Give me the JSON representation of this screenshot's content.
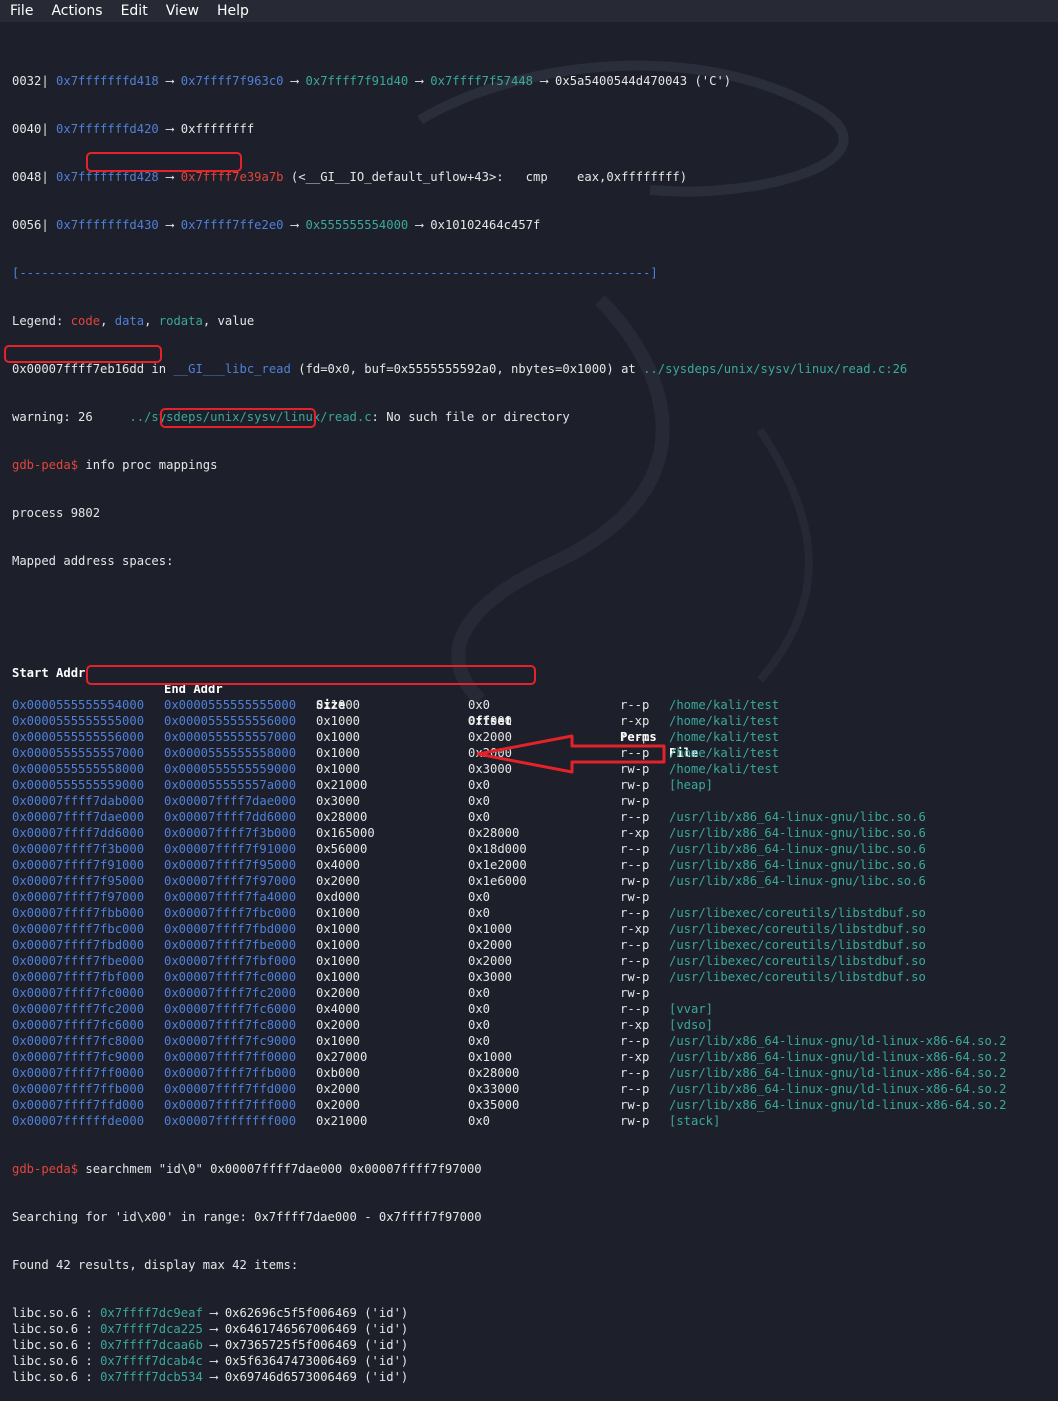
{
  "menu": [
    "File",
    "Actions",
    "Edit",
    "View",
    "Help"
  ],
  "stack_lines": [
    {
      "off": "0032|",
      "a": "0x7fffffffd418",
      "b": "0x7ffff7f963c0",
      "c": "0x7ffff7f91d40",
      "d": "0x7ffff7f57448",
      "e": "0x5a5400544d470043 ('C')"
    },
    {
      "off": "0040|",
      "a": "0x7fffffffd420",
      "b": "0xffffffff"
    },
    {
      "off": "0048|",
      "a": "0x7fffffffd428",
      "b": "0x7ffff7e39a7b",
      "c": "(<__GI__IO_default_uflow+43>:",
      "d": "cmp",
      "e": "eax,0xffffffff)"
    },
    {
      "off": "0056|",
      "a": "0x7fffffffd430",
      "b": "0x7ffff7ffe2e0",
      "c": "0x555555554000",
      "d": "0x10102464c457f"
    }
  ],
  "separator": "[--------------------------------------------------------------------------------------]",
  "legend": {
    "prefix": "Legend: ",
    "code": "code",
    "data": "data",
    "rodata": "rodata",
    "value": "value"
  },
  "frame": {
    "addr": "0x00007ffff7eb16dd",
    "in": "in",
    "func": "__GI___libc_read",
    "args_open": "(fd=0x0, buf=0x5555555592a0, nbytes=0x1000)",
    "at": "at",
    "path": "../sysdeps/unix/sysv/linux/read.c:26"
  },
  "warning": {
    "text": "warning: 26",
    "path": "../sysdeps/unix/sysv/linux/read.c",
    "msg": ": No such file or directory"
  },
  "prompt1": {
    "prompt": "gdb-peda$",
    "cmd": "info proc mappings"
  },
  "process": "process 9802",
  "mapped": "Mapped address spaces:",
  "headers": {
    "start": "Start Addr",
    "end": "End Addr",
    "size": "Size",
    "offset": "Offset",
    "perms": "Perms",
    "file": "File"
  },
  "mappings": [
    [
      "0x0000555555554000",
      "0x0000555555555000",
      "0x1000",
      "0x0",
      "r--p",
      "/home/kali/test"
    ],
    [
      "0x0000555555555000",
      "0x0000555555556000",
      "0x1000",
      "0x1000",
      "r-xp",
      "/home/kali/test"
    ],
    [
      "0x0000555555556000",
      "0x0000555555557000",
      "0x1000",
      "0x2000",
      "r--p",
      "/home/kali/test"
    ],
    [
      "0x0000555555557000",
      "0x0000555555558000",
      "0x1000",
      "0x2000",
      "r--p",
      "/home/kali/test"
    ],
    [
      "0x0000555555558000",
      "0x0000555555559000",
      "0x1000",
      "0x3000",
      "rw-p",
      "/home/kali/test"
    ],
    [
      "0x0000555555559000",
      "0x000055555557a000",
      "0x21000",
      "0x0",
      "rw-p",
      "[heap]"
    ],
    [
      "0x00007ffff7dab000",
      "0x00007ffff7dae000",
      "0x3000",
      "0x0",
      "rw-p",
      ""
    ],
    [
      "0x00007ffff7dae000",
      "0x00007ffff7dd6000",
      "0x28000",
      "0x0",
      "r--p",
      "/usr/lib/x86_64-linux-gnu/libc.so.6"
    ],
    [
      "0x00007ffff7dd6000",
      "0x00007ffff7f3b000",
      "0x165000",
      "0x28000",
      "r-xp",
      "/usr/lib/x86_64-linux-gnu/libc.so.6"
    ],
    [
      "0x00007ffff7f3b000",
      "0x00007ffff7f91000",
      "0x56000",
      "0x18d000",
      "r--p",
      "/usr/lib/x86_64-linux-gnu/libc.so.6"
    ],
    [
      "0x00007ffff7f91000",
      "0x00007ffff7f95000",
      "0x4000",
      "0x1e2000",
      "r--p",
      "/usr/lib/x86_64-linux-gnu/libc.so.6"
    ],
    [
      "0x00007ffff7f95000",
      "0x00007ffff7f97000",
      "0x2000",
      "0x1e6000",
      "rw-p",
      "/usr/lib/x86_64-linux-gnu/libc.so.6"
    ],
    [
      "0x00007ffff7f97000",
      "0x00007ffff7fa4000",
      "0xd000",
      "0x0",
      "rw-p",
      ""
    ],
    [
      "0x00007ffff7fbb000",
      "0x00007ffff7fbc000",
      "0x1000",
      "0x0",
      "r--p",
      "/usr/libexec/coreutils/libstdbuf.so"
    ],
    [
      "0x00007ffff7fbc000",
      "0x00007ffff7fbd000",
      "0x1000",
      "0x1000",
      "r-xp",
      "/usr/libexec/coreutils/libstdbuf.so"
    ],
    [
      "0x00007ffff7fbd000",
      "0x00007ffff7fbe000",
      "0x1000",
      "0x2000",
      "r--p",
      "/usr/libexec/coreutils/libstdbuf.so"
    ],
    [
      "0x00007ffff7fbe000",
      "0x00007ffff7fbf000",
      "0x1000",
      "0x2000",
      "r--p",
      "/usr/libexec/coreutils/libstdbuf.so"
    ],
    [
      "0x00007ffff7fbf000",
      "0x00007ffff7fc0000",
      "0x1000",
      "0x3000",
      "rw-p",
      "/usr/libexec/coreutils/libstdbuf.so"
    ],
    [
      "0x00007ffff7fc0000",
      "0x00007ffff7fc2000",
      "0x2000",
      "0x0",
      "rw-p",
      ""
    ],
    [
      "0x00007ffff7fc2000",
      "0x00007ffff7fc6000",
      "0x4000",
      "0x0",
      "r--p",
      "[vvar]"
    ],
    [
      "0x00007ffff7fc6000",
      "0x00007ffff7fc8000",
      "0x2000",
      "0x0",
      "r-xp",
      "[vdso]"
    ],
    [
      "0x00007ffff7fc8000",
      "0x00007ffff7fc9000",
      "0x1000",
      "0x0",
      "r--p",
      "/usr/lib/x86_64-linux-gnu/ld-linux-x86-64.so.2"
    ],
    [
      "0x00007ffff7fc9000",
      "0x00007ffff7ff0000",
      "0x27000",
      "0x1000",
      "r-xp",
      "/usr/lib/x86_64-linux-gnu/ld-linux-x86-64.so.2"
    ],
    [
      "0x00007ffff7ff0000",
      "0x00007ffff7ffb000",
      "0xb000",
      "0x28000",
      "r--p",
      "/usr/lib/x86_64-linux-gnu/ld-linux-x86-64.so.2"
    ],
    [
      "0x00007ffff7ffb000",
      "0x00007ffff7ffd000",
      "0x2000",
      "0x33000",
      "r--p",
      "/usr/lib/x86_64-linux-gnu/ld-linux-x86-64.so.2"
    ],
    [
      "0x00007ffff7ffd000",
      "0x00007ffff7fff000",
      "0x2000",
      "0x35000",
      "rw-p",
      "/usr/lib/x86_64-linux-gnu/ld-linux-x86-64.so.2"
    ],
    [
      "0x00007ffffffde000",
      "0x00007ffffffff000",
      "0x21000",
      "0x0",
      "rw-p",
      "[stack]"
    ]
  ],
  "prompt2": {
    "prompt": "gdb-peda$",
    "cmd": "searchmem \"id\\0\" 0x00007ffff7dae000 0x00007ffff7f97000"
  },
  "searching": "Searching for 'id\\x00' in range: 0x7ffff7dae000 - 0x7ffff7f97000",
  "found": "Found 42 results, display max 42 items:",
  "results": [
    {
      "lib": "libc.so.6 :",
      "addr": "0x7ffff7dc9eaf",
      "val": "0x62696c5f5f006469 ('id')"
    },
    {
      "lib": "libc.so.6 :",
      "addr": "0x7ffff7dca225",
      "val": "0x6461746567006469 ('id')"
    },
    {
      "lib": "libc.so.6 :",
      "addr": "0x7ffff7dcaa6b",
      "val": "0x7365725f5f006469 ('id')"
    },
    {
      "lib": "libc.so.6 :",
      "addr": "0x7ffff7dcab4c",
      "val": "0x5f63647473006469 ('id')"
    },
    {
      "lib": "libc.so.6 :",
      "addr": "0x7ffff7dcb534",
      "val": "0x69746d6573006469 ('id')"
    }
  ],
  "colors": {
    "background": "#1d1f2a",
    "code": "#e0463c",
    "data": "#4f80d8",
    "rodata": "#3aa99b",
    "highlight": "#e3222a"
  }
}
